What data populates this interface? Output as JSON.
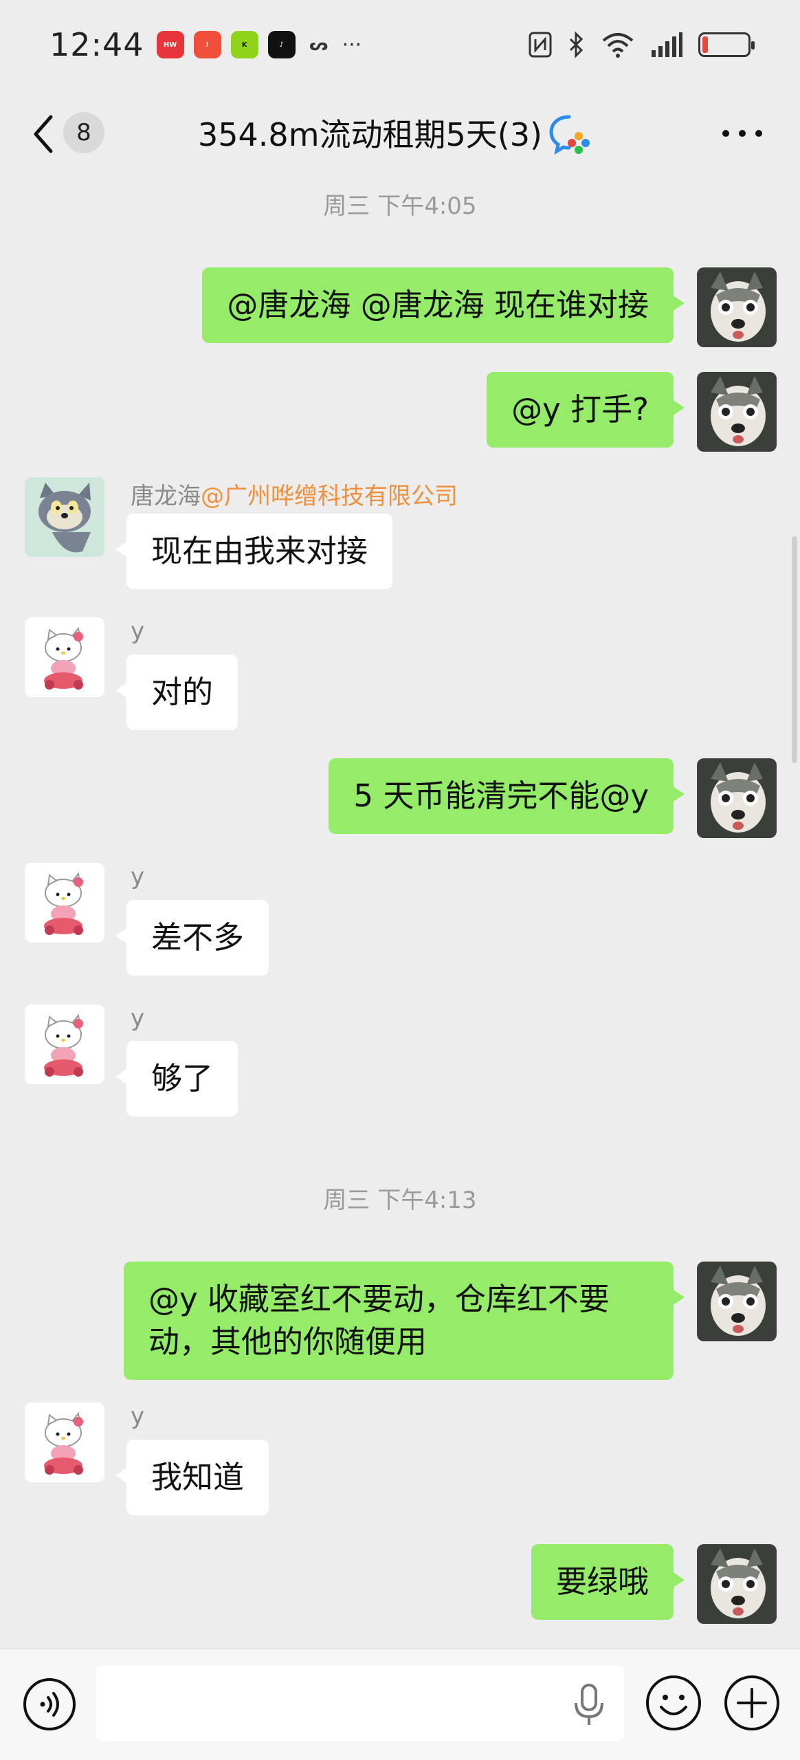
{
  "status_bar": {
    "time": "12:44",
    "notification_apps": [
      "huawei-mall-icon",
      "alert-app-icon",
      "kook-app-icon",
      "tiktok-app-icon",
      "link-app-icon"
    ],
    "more_indicator": "···",
    "battery_level": 0.12,
    "battery_color": "#e84a3a"
  },
  "header": {
    "unread_count": "8",
    "title": "354.8m流动租期5天(3)"
  },
  "messages": [
    {
      "kind": "timestamp",
      "text": "周三 下午4:05"
    },
    {
      "kind": "out",
      "text": "@唐龙海 @唐龙海  现在谁对接"
    },
    {
      "kind": "out",
      "text": "@y  打手?"
    },
    {
      "kind": "in",
      "sender": "唐龙海",
      "sender_org": "@广州哗缯科技有限公司",
      "text": "现在由我来对接"
    },
    {
      "kind": "in",
      "sender": "y",
      "text": "对的"
    },
    {
      "kind": "out",
      "text": "5 天币能清完不能@y"
    },
    {
      "kind": "in",
      "sender": "y",
      "text": "差不多"
    },
    {
      "kind": "in",
      "sender": "y",
      "text": "够了"
    },
    {
      "kind": "timestamp",
      "text": "周三 下午4:13"
    },
    {
      "kind": "out",
      "text_line1": "@y  收藏室红不要动，仓库红不要",
      "text_line2": "动，其他的你随便用"
    },
    {
      "kind": "in",
      "sender": "y",
      "text": "我知道"
    },
    {
      "kind": "out",
      "text": "要绿哦"
    }
  ],
  "input_bar": {
    "placeholder": ""
  },
  "colors": {
    "background": "#ededed",
    "outgoing_bubble": "#95ec69",
    "incoming_bubble": "#ffffff",
    "org_name": "#f0903a",
    "timestamp": "#9a9a9a"
  }
}
